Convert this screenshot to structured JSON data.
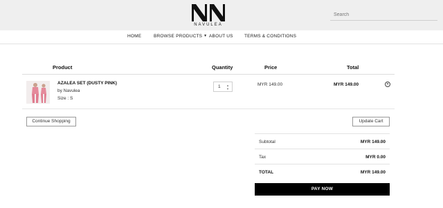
{
  "brand": {
    "name": "NAVULEA",
    "logo_icon": "navulea-monogram-icon"
  },
  "search": {
    "placeholder": "Search"
  },
  "nav": {
    "home": "HOME",
    "browse": "BROWSE PRODUCTS",
    "about": "ABOUT US",
    "terms": "TERMS & CONDITIONS"
  },
  "cart": {
    "headers": {
      "product": "Product",
      "quantity": "Quantity",
      "price": "Price",
      "total": "Total"
    },
    "items": [
      {
        "name": "AZALEA SET (DUSTY PINK)",
        "vendor": "by Navulea",
        "size": "Size : S",
        "quantity": "1",
        "price": "MYR 149.00",
        "total": "MYR 149.00",
        "remove_icon": "remove-circle-icon"
      }
    ],
    "continue_label": "Continue Shopping",
    "update_label": "Update Cart"
  },
  "totals": {
    "subtotal_label": "Subtotal",
    "subtotal_value": "MYR 149.00",
    "tax_label": "Tax",
    "tax_value": "MYR 0.00",
    "total_label": "TOTAL",
    "total_value": "MYR 149.00"
  },
  "pay_label": "PAY NOW",
  "colors": {
    "header_bg": "#efefef",
    "pay_button": "#000000",
    "product_pink": "#e58a9b"
  }
}
